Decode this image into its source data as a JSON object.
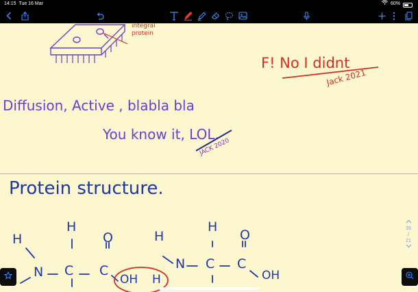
{
  "status": {
    "time": "14:15",
    "date": "Tue 16 Mar",
    "battery_text": "60%",
    "battery_level": 0.6
  },
  "toolbar": {
    "icons": [
      "chevron-left-icon",
      "share-icon",
      "undo-icon",
      "text-tool-icon",
      "pen-icon",
      "highlighter-icon",
      "eraser-icon",
      "lasso-icon",
      "image-icon",
      "microphone-icon",
      "add-icon",
      "more-icon",
      "pages-icon"
    ],
    "accent": "#3d8bff",
    "pen_color": "#e23b2e"
  },
  "page": {
    "background": "#fdf7cf",
    "notes": {
      "integral_protein": [
        "integral",
        "protein"
      ],
      "fake_reply": "F! No I didnt",
      "signature_1": "Jack 2021",
      "diffusion": "Diffusion, Active , blabla bla",
      "you_know_it": "You know it, LOL.",
      "signature_2": "JACK 2020",
      "protein_heading": "Protein structure.",
      "atoms": {
        "h_left": "H",
        "n_left": "N",
        "h_top": "H",
        "c_alpha": "C",
        "c_carbonyl": "C",
        "o_top": "O",
        "oh_group": "OH",
        "h_middle": "H",
        "h_amine": "H",
        "n_right": "N",
        "h_top_right": "H",
        "c_alpha_right": "C",
        "c_carbonyl_right": "C",
        "o_top_right": "O",
        "oh_right": "OH"
      }
    }
  },
  "navigation": {
    "current_page": "16",
    "divider": "/",
    "total_pages": "21"
  },
  "colors": {
    "purple_ink": "#6a3fcf",
    "red_ink": "#d42f24",
    "navy_ink": "#1d2a8c",
    "blue_ink": "#1f36a8"
  }
}
